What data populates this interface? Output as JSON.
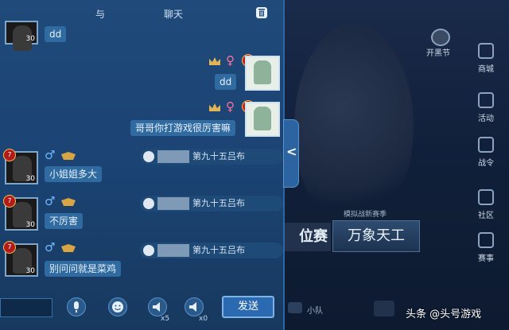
{
  "chat": {
    "header_title": "与",
    "header_suffix": "聊天",
    "trash_icon": "trash-icon",
    "messages": [
      {
        "text": "dd",
        "side": "left",
        "level": "",
        "avatar_num": "30"
      },
      {
        "text": "dd",
        "side": "right",
        "level": "6"
      },
      {
        "text": "哥哥你打游戏很厉害嘛",
        "side": "right",
        "level": "6"
      },
      {
        "text": "小姐姐多大",
        "side": "left",
        "level": "7",
        "avatar_num": "30",
        "meta": "第九十五吕布"
      },
      {
        "text": "不厉害",
        "side": "left",
        "level": "7",
        "avatar_num": "30",
        "meta": "第九十五吕布"
      },
      {
        "text": "别问问就是菜鸡",
        "side": "left",
        "level": "7",
        "avatar_num": "30",
        "meta": "第九十五吕布"
      }
    ],
    "send_label": "发送",
    "voice_count": "x5",
    "voice2_count": "x0"
  },
  "sidebar": {
    "event_label": "开黑节",
    "items": [
      "商城",
      "活动",
      "战令",
      "社区",
      "赛事"
    ]
  },
  "game": {
    "mode_sub": "模拟战新赛季",
    "mode_left": "位赛",
    "mode_main": "万象天工",
    "team_label": "小队"
  },
  "watermark": "头条 @头号游戏",
  "colors": {
    "panel": "#1f4a7a",
    "bubble": "#2f6aa0",
    "female": "#ff6fa0",
    "male": "#6fb8ff"
  }
}
